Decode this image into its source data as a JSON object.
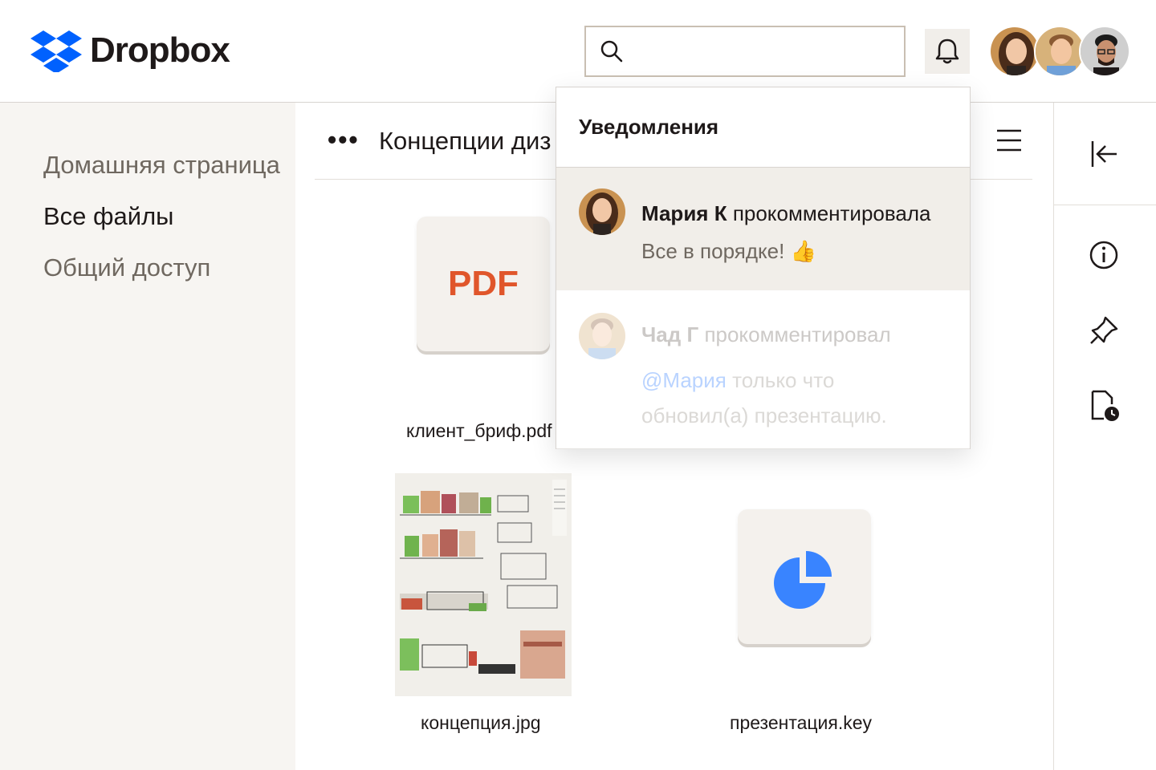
{
  "app": {
    "brand": "Dropbox"
  },
  "header": {
    "search": {
      "placeholder": "",
      "value": ""
    },
    "bell_icon": "bell-icon",
    "avatars": [
      "avatar-maria",
      "avatar-chad",
      "avatar-third"
    ]
  },
  "sidebar": {
    "items": [
      {
        "label": "Домашняя страница",
        "active": false
      },
      {
        "label": "Все файлы",
        "active": true
      },
      {
        "label": "Общий доступ",
        "active": false
      }
    ]
  },
  "breadcrumb": {
    "more_icon": "•••",
    "title": "Концепции диз"
  },
  "files": [
    {
      "name": "клиент_бриф.pdf",
      "type_label": "PDF"
    },
    {
      "name": "концепция.jpg",
      "type_label": ""
    },
    {
      "name": "презентация.key",
      "type_label": ""
    }
  ],
  "notifications": {
    "title": "Уведомления",
    "items": [
      {
        "author": "Мария К",
        "action": "прокомментировала",
        "text": "Все в порядке! 👍"
      },
      {
        "author": "Чад Г",
        "action": "прокомментировал",
        "mention": "@Мария",
        "text": "только что обновил(а) презентацию."
      }
    ]
  },
  "colors": {
    "brand": "#0061fe",
    "pdf": "#e0562b",
    "keynote": "#3984ff",
    "mention": "#3984ff",
    "sidebar_bg": "#f7f5f2",
    "highlight_bg": "#f1eee9"
  }
}
